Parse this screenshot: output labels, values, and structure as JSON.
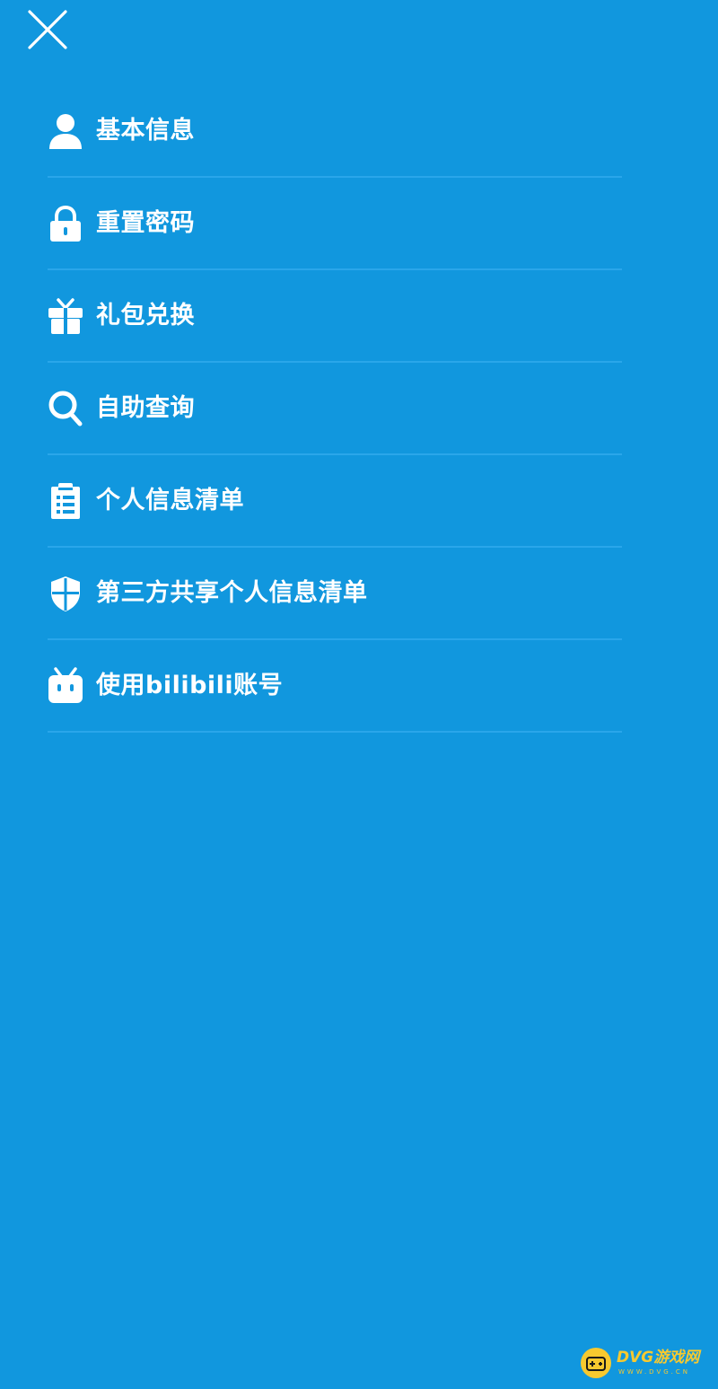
{
  "header": {
    "close_icon": "close-icon"
  },
  "menu": {
    "items": [
      {
        "label": "基本信息",
        "icon": "user-icon"
      },
      {
        "label": "重置密码",
        "icon": "lock-icon"
      },
      {
        "label": "礼包兑换",
        "icon": "gift-icon"
      },
      {
        "label": "自助查询",
        "icon": "search-icon"
      },
      {
        "label": "个人信息清单",
        "icon": "clipboard-icon"
      },
      {
        "label": "第三方共享个人信息清单",
        "icon": "shield-icon"
      },
      {
        "label": "使用bilibili账号",
        "icon": "bilibili-icon"
      }
    ]
  },
  "watermark": {
    "text": "DVG游戏网",
    "sub": "WWW.DVG.CN"
  },
  "colors": {
    "background": "#1197de",
    "divider": "#2aa6ea",
    "foreground": "#ffffff",
    "watermark": "#f7c92f"
  }
}
